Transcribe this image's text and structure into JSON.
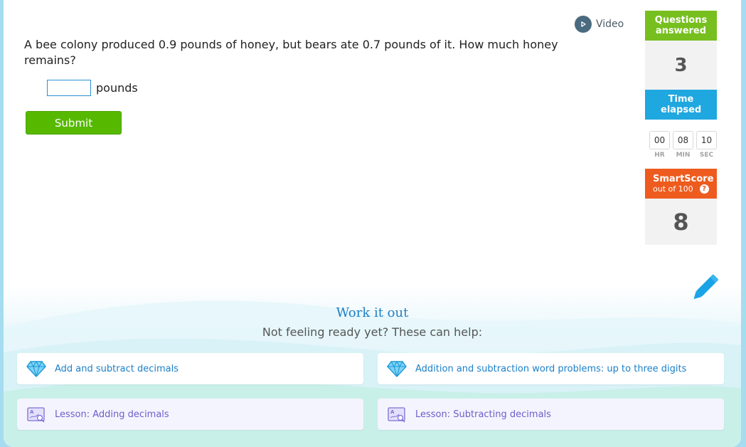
{
  "video": {
    "label": "Video",
    "icon": "play-icon"
  },
  "question": {
    "text": "A bee colony produced 0.9 pounds of honey, but bears ate 0.7 pounds of it. How much honey remains?",
    "answer_value": "",
    "unit": "pounds",
    "submit_label": "Submit"
  },
  "sidebar": {
    "questions_answered": {
      "label": "Questions answered",
      "value": "3"
    },
    "time_elapsed": {
      "label": "Time elapsed",
      "hr": "00",
      "min": "08",
      "sec": "10",
      "hr_label": "HR",
      "min_label": "MIN",
      "sec_label": "SEC"
    },
    "smartscore": {
      "label": "SmartScore",
      "sublabel": "out of 100",
      "help": "?",
      "value": "8"
    }
  },
  "work_it_out": {
    "title": "Work it out",
    "subtitle": "Not feeling ready yet? These can help:",
    "cards": [
      {
        "label": "Add and subtract decimals",
        "icon": "diamond-icon"
      },
      {
        "label": "Addition and subtraction word problems: up to three digits",
        "icon": "diamond-icon"
      },
      {
        "label": "Lesson: Adding decimals",
        "icon": "lesson-icon"
      },
      {
        "label": "Lesson: Subtracting decimals",
        "icon": "lesson-icon"
      }
    ]
  },
  "colors": {
    "accent_green": "#56b900",
    "questions_green": "#77bf1e",
    "time_blue": "#1fa7e0",
    "smartscore_orange": "#ee5b1e",
    "link_blue": "#1a7fc8",
    "lesson_purple": "#6a5fc9"
  }
}
